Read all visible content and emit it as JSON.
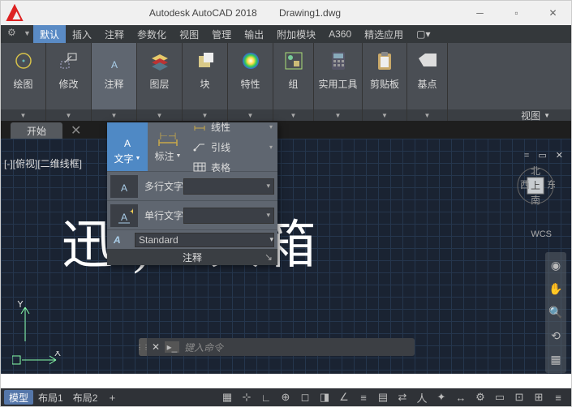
{
  "title": {
    "app": "Autodesk AutoCAD 2018",
    "file": "Drawing1.dwg"
  },
  "menu": {
    "default": "默认",
    "insert": "插入",
    "annotate": "注释",
    "param": "参数化",
    "view": "视图",
    "manage": "管理",
    "output": "输出",
    "addons": "附加模块",
    "a360": "A360",
    "featured": "精选应用"
  },
  "ribbon": {
    "draw": "绘图",
    "modify": "修改",
    "annotate": "注释",
    "layer": "图层",
    "block": "块",
    "prop": "特性",
    "group": "组",
    "util": "实用工具",
    "clip": "剪贴板",
    "base": "基点",
    "view": "视图"
  },
  "file_tabs": {
    "start": "开始"
  },
  "viewport": {
    "label": "[-][俯视][二维线框]",
    "controls": "= ▭ ✕"
  },
  "watermark": "迅                   )工具箱",
  "wcs": "WCS",
  "cmd": {
    "placeholder": "键入命令"
  },
  "status": {
    "model": "模型",
    "layout1": "布局1",
    "layout2": "布局2"
  },
  "flyout": {
    "text": "文字",
    "dim": "标注",
    "linear": "线性",
    "leader": "引线",
    "table": "表格",
    "mtext": "多行文字",
    "dtext": "单行文字",
    "standard": "Standard",
    "foot": "注释"
  }
}
